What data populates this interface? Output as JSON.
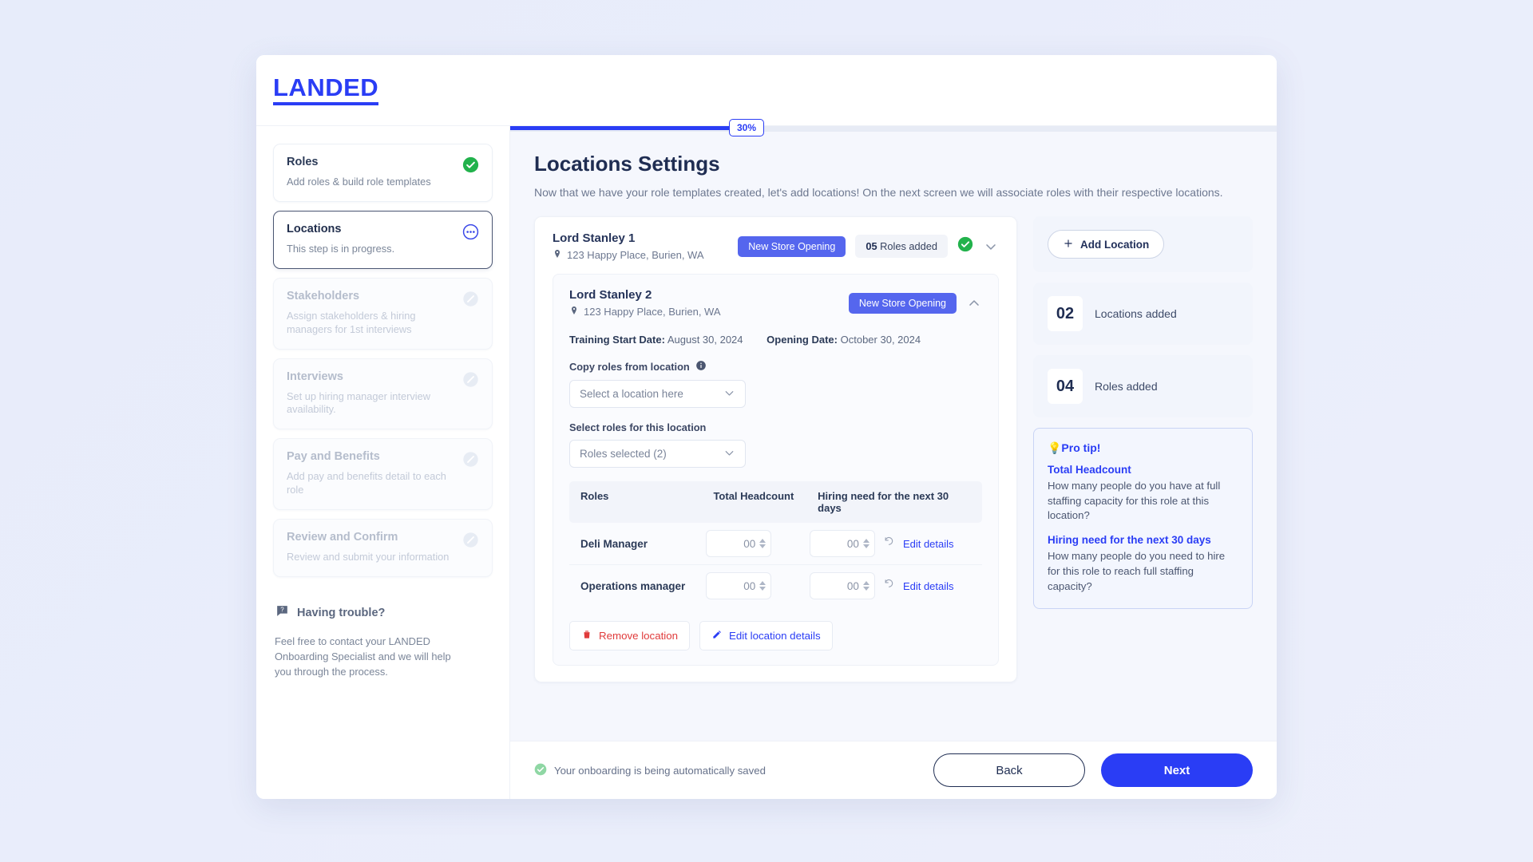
{
  "brand": {
    "name": "LANDED"
  },
  "sidebar": {
    "steps": [
      {
        "title": "Roles",
        "desc": "Add roles & build role templates",
        "state": "done",
        "icon": "check-circle-icon"
      },
      {
        "title": "Locations",
        "desc": "This step is in progress.",
        "state": "active",
        "icon": "dots-circle-icon"
      },
      {
        "title": "Stakeholders",
        "desc": "Assign stakeholders & hiring managers for 1st interviews",
        "state": "locked",
        "icon": "locked-circle-icon"
      },
      {
        "title": "Interviews",
        "desc": "Set up hiring manager interview availability.",
        "state": "locked",
        "icon": "locked-circle-icon"
      },
      {
        "title": "Pay and Benefits",
        "desc": "Add pay and benefits detail to each role",
        "state": "locked",
        "icon": "locked-circle-icon"
      },
      {
        "title": "Review and Confirm",
        "desc": "Review and submit your information",
        "state": "locked",
        "icon": "locked-circle-icon"
      }
    ],
    "help": {
      "title": "Having trouble?",
      "body": "Feel free to contact your LANDED Onboarding Specialist and we will help you through the process.",
      "icon": "question-bubble-icon"
    }
  },
  "progress": {
    "percent": "30%",
    "value": 30
  },
  "page": {
    "title": "Locations Settings",
    "subtitle": "Now that we have your role templates created, let's add locations! On the next screen we will associate roles with their respective locations."
  },
  "locations": [
    {
      "name": "Lord Stanley 1",
      "address": "123 Happy Place, Burien, WA",
      "tag": "New Store Opening",
      "roles_count": "05",
      "roles_label": "Roles added",
      "status_icon": "check-circle-icon",
      "expanded": false,
      "chevron": "chevron-down-icon"
    },
    {
      "name": "Lord Stanley 2",
      "address": "123 Happy Place, Burien, WA",
      "tag": "New Store Opening",
      "expanded": true,
      "chevron": "chevron-up-icon",
      "training_start_label": "Training Start Date:",
      "training_start_value": "August 30, 2024",
      "opening_label": "Opening Date:",
      "opening_value": "October 30, 2024",
      "copy_roles_label": "Copy roles from location",
      "copy_roles_value": "Select a location here",
      "select_roles_label": "Select roles for this location",
      "select_roles_value": "Roles selected (2)",
      "table": {
        "headers": [
          "Roles",
          "Total Headcount",
          "Hiring need for the next 30 days"
        ],
        "rows": [
          {
            "role": "Deli Manager",
            "headcount": "00",
            "hiring_need": "00",
            "edit": "Edit details"
          },
          {
            "role": "Operations manager",
            "headcount": "00",
            "hiring_need": "00",
            "edit": "Edit details"
          }
        ]
      },
      "remove_label": "Remove location",
      "edit_label": "Edit location details"
    }
  ],
  "rail": {
    "add_location": "Add Location",
    "stats": [
      {
        "num": "02",
        "label": "Locations added"
      },
      {
        "num": "04",
        "label": "Roles added"
      }
    ],
    "protip": {
      "heading": "💡Pro tip!",
      "blocks": [
        {
          "title": "Total Headcount",
          "text": "How many people do you have at full staffing capacity for this role at this location?"
        },
        {
          "title": "Hiring need for the next 30 days",
          "text": "How many people do you need to hire for this role to reach full staffing capacity?"
        }
      ]
    }
  },
  "footer": {
    "saved_text": "Your onboarding is being automatically saved",
    "saved_icon": "check-circle-icon",
    "back": "Back",
    "next": "Next"
  },
  "colors": {
    "brand": "#2a3df5",
    "tag": "#5566ee",
    "success": "#22b24c",
    "danger": "#e03b3b",
    "title": "#1f2d52"
  }
}
